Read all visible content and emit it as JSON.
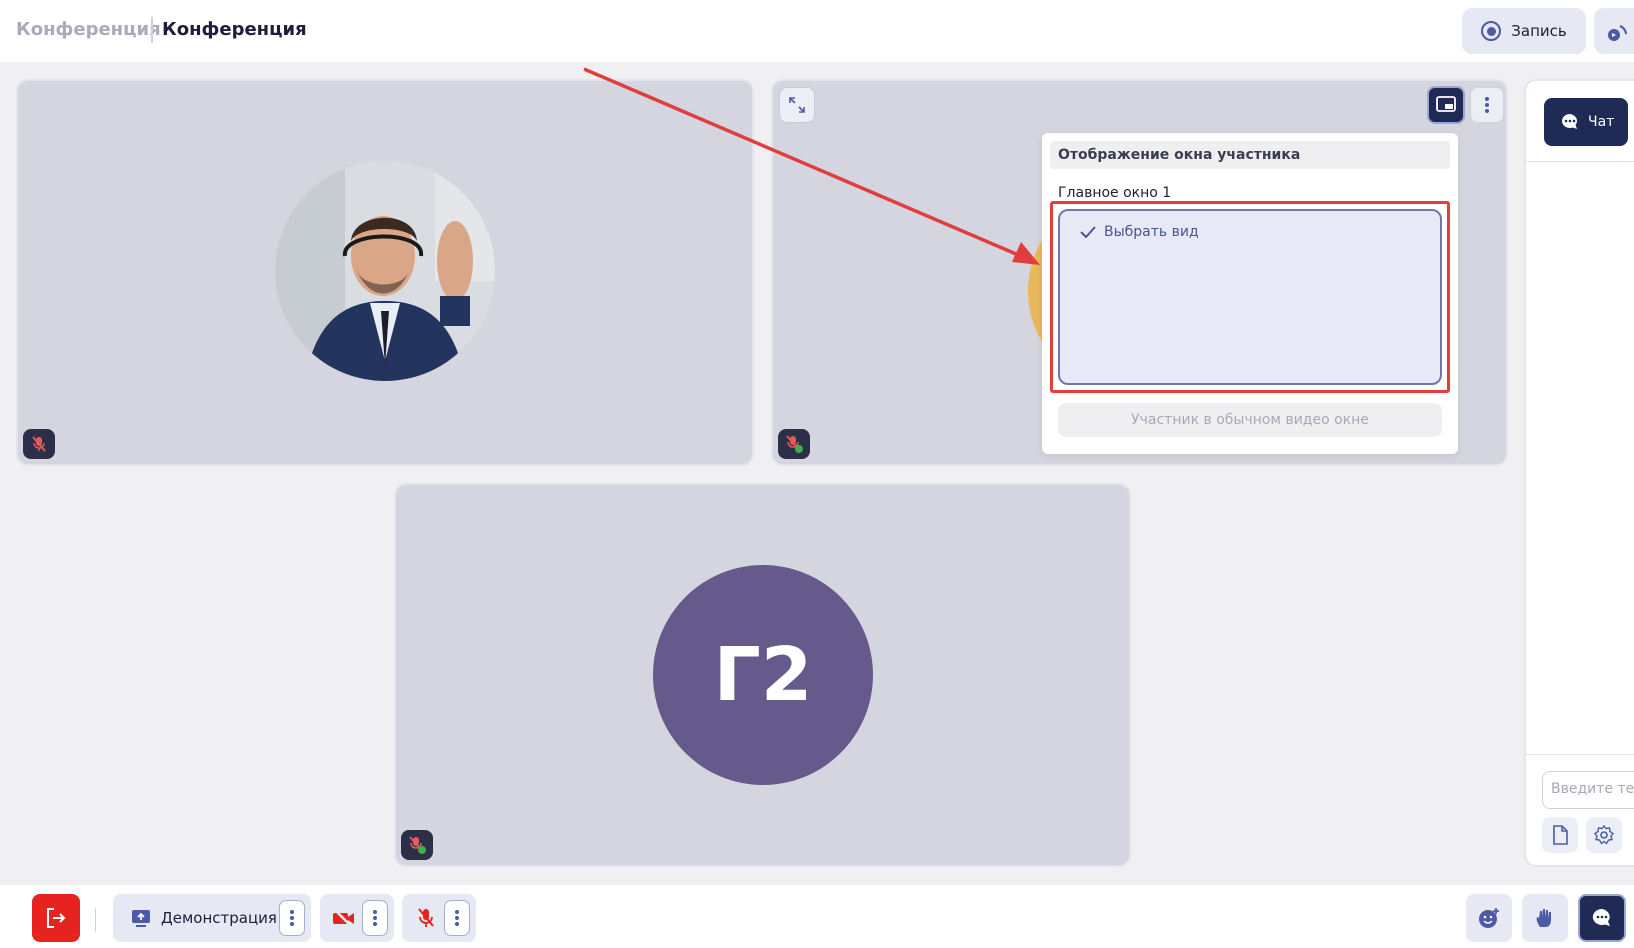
{
  "header": {
    "breadcrumb_parent": "Конференция",
    "breadcrumb_current": "Конференция",
    "record_label": "Запись"
  },
  "tiles": [
    {
      "id": "tile-1",
      "avatar": "photo-man-waving",
      "mic": "muted"
    },
    {
      "id": "tile-2",
      "mic": "muted-raise"
    },
    {
      "id": "tile-3",
      "initials": "Г2",
      "mic": "muted-raise"
    }
  ],
  "popup": {
    "title": "Отображение окна участника",
    "subtitle": "Главное окно 1",
    "option_label": "Выбрать вид",
    "normal_label": "Участник в обычном видео окне"
  },
  "chat": {
    "tab_label": "Чат",
    "input_placeholder": "Введите текст"
  },
  "toolbar": {
    "demo_label": "Демонстрация"
  },
  "colors": {
    "accent": "#1f2a55",
    "danger": "#e6231f",
    "highlight": "#e03d3d",
    "avatar_bg": "#66598c"
  },
  "icons": [
    "record-icon",
    "stream-icon",
    "expand-icon",
    "layout-icon",
    "more-icon",
    "check-icon",
    "mic-off-icon",
    "chat-icon",
    "file-icon",
    "gear-icon",
    "exit-icon",
    "screen-share-icon",
    "camera-off-icon",
    "emoji-icon",
    "hand-icon"
  ]
}
